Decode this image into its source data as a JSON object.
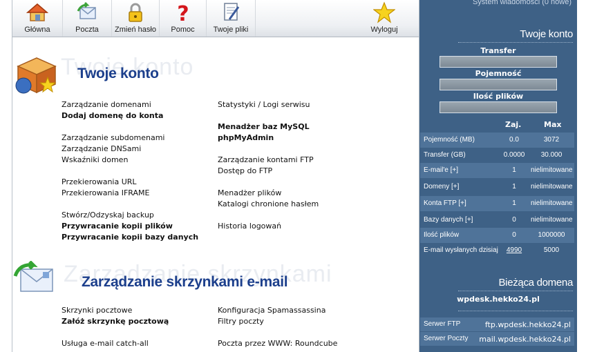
{
  "toolbar": {
    "items": [
      {
        "label": "Główna",
        "icon": "home-icon"
      },
      {
        "label": "Poczta",
        "icon": "mail-icon"
      },
      {
        "label": "Zmień hasło",
        "icon": "lock-icon"
      },
      {
        "label": "Pomoc",
        "icon": "help-icon"
      },
      {
        "label": "Twoje pliki",
        "icon": "files-icon"
      },
      {
        "label": "Wyloguj",
        "icon": "star-icon"
      }
    ]
  },
  "account": {
    "title": "Twoje konto",
    "ghost": "Twoje konto",
    "left": [
      "Zarządzanie domenami",
      "Dodaj domenę do konta",
      "Zarządzanie subdomenami",
      "Zarządzanie DNSami",
      "Wskaźniki domen",
      "Przekierowania URL",
      "Przekierowania IFRAME",
      "Stwórz/Odzyskaj backup",
      "Przywracanie kopii plików",
      "Przywracanie kopii bazy danych"
    ],
    "right": [
      "Statystyki / Logi serwisu",
      "Menadżer baz MySQL",
      "phpMyAdmin",
      "Zarządzanie kontami FTP",
      "Dostęp do FTP",
      "Menadżer plików",
      "Katalogi chronione hasłem",
      "Historia logowań"
    ]
  },
  "mail": {
    "title": "Zarządzanie skrzynkami e-mail",
    "ghost": "Zarządzanie skrzynkami",
    "left": [
      "Skrzynki pocztowe",
      "Załóż skrzynkę pocztową",
      "Usługa e-mail catch-all"
    ],
    "right": [
      "Konfiguracja Spamassassina",
      "Filtry poczty",
      "Poczta przez WWW: Roundcube"
    ]
  },
  "panel": {
    "top_text": "System wiadomości (0 nowe)",
    "account_title": "Twoje konto",
    "labels": [
      "Transfer",
      "Pojemność",
      "Ilość plików"
    ],
    "col_used": "Zaj.",
    "col_max": "Max",
    "rows": [
      {
        "name": "Pojemność (MB)",
        "used": "0.0",
        "max": "3072"
      },
      {
        "name": "Transfer (GB)",
        "used": "0.0000",
        "max": "30.000"
      },
      {
        "name": "E-mail'e [+]",
        "used": "1",
        "max": "nielimitowane"
      },
      {
        "name": "Domeny [+]",
        "used": "1",
        "max": "nielimitowane"
      },
      {
        "name": "Konta FTP [+]",
        "used": "1",
        "max": "nielimitowane"
      },
      {
        "name": "Bazy danych [+]",
        "used": "0",
        "max": "nielimitowane"
      },
      {
        "name": "Ilość plików",
        "used": "0",
        "max": "1000000"
      },
      {
        "name": "E-mail wysłanych dzisiaj",
        "used": "4990",
        "max": "5000"
      }
    ],
    "domain_title": "Bieżąca domena",
    "domain": "wpdesk.hekko24.pl",
    "servers": [
      {
        "name": "Serwer FTP",
        "value": "ftp.wpdesk.hekko24.pl"
      },
      {
        "name": "Serwer Poczty",
        "value": "mail.wpdesk.hekko24.pl"
      }
    ],
    "colors": {
      "panel": "#3e6186",
      "row_alt": "#4f7399",
      "title": "#1c3f8c"
    }
  }
}
